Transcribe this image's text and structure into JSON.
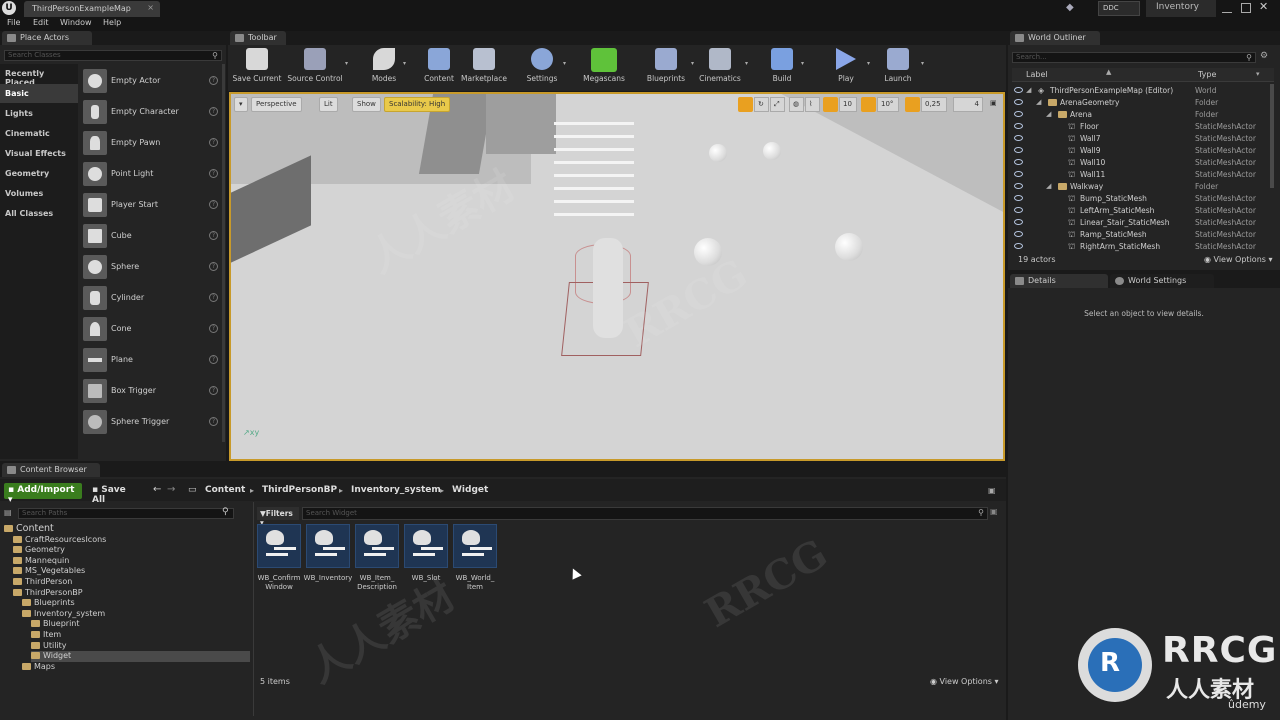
{
  "title_bar": {
    "map_tab": "ThirdPersonExampleMap",
    "ddc_label": "DDC",
    "project_label": "Inventory"
  },
  "menu": [
    "File",
    "Edit",
    "Window",
    "Help"
  ],
  "place_actors": {
    "tab_label": "Place Actors",
    "search_placeholder": "Search Classes",
    "categories": [
      "Recently Placed",
      "Basic",
      "Lights",
      "Cinematic",
      "Visual Effects",
      "Geometry",
      "Volumes",
      "All Classes"
    ],
    "selected_category": "Basic",
    "actors": [
      "Empty Actor",
      "Empty Character",
      "Empty Pawn",
      "Point Light",
      "Player Start",
      "Cube",
      "Sphere",
      "Cylinder",
      "Cone",
      "Plane",
      "Box Trigger",
      "Sphere Trigger"
    ]
  },
  "toolbar": {
    "tab_label": "Toolbar",
    "buttons": [
      {
        "label": "Save Current",
        "icon": "save-icon",
        "color": "#d8d8d8"
      },
      {
        "label": "Source Control",
        "icon": "source-control-icon",
        "color": "#9aa0b8"
      },
      {
        "label": "Modes",
        "icon": "modes-icon",
        "color": "#d8d8d8"
      },
      {
        "label": "Content",
        "icon": "content-icon",
        "color": "#8aa6d8"
      },
      {
        "label": "Marketplace",
        "icon": "marketplace-icon",
        "color": "#b8c0d0"
      },
      {
        "label": "Settings",
        "icon": "settings-icon",
        "color": "#8aa6d8"
      },
      {
        "label": "Megascans",
        "icon": "megascans-icon",
        "color": "#5fc23a"
      },
      {
        "label": "Blueprints",
        "icon": "blueprints-icon",
        "color": "#9aaad0"
      },
      {
        "label": "Cinematics",
        "icon": "cinematics-icon",
        "color": "#b0b8c8"
      },
      {
        "label": "Build",
        "icon": "build-icon",
        "color": "#7aa0e0"
      },
      {
        "label": "Play",
        "icon": "play-icon",
        "color": "#8aa6e8"
      },
      {
        "label": "Launch",
        "icon": "launch-icon",
        "color": "#9aaad0"
      }
    ]
  },
  "viewport": {
    "perspective": "Perspective",
    "lit": "Lit",
    "show": "Show",
    "scalability": "Scalability: High",
    "grid_snap": "10",
    "rot_snap": "10°",
    "scale_snap": "0,25",
    "cam_speed": "4"
  },
  "outliner": {
    "tab_label": "World Outliner",
    "search_placeholder": "Search...",
    "col_label": "Label",
    "col_type": "Type",
    "rows": [
      {
        "name": "ThirdPersonExampleMap (Editor)",
        "type": "World",
        "indent": 0,
        "kind": "world"
      },
      {
        "name": "ArenaGeometry",
        "type": "Folder",
        "indent": 1,
        "kind": "folder"
      },
      {
        "name": "Arena",
        "type": "Folder",
        "indent": 2,
        "kind": "folder"
      },
      {
        "name": "Floor",
        "type": "StaticMeshActor",
        "indent": 3,
        "kind": "mesh"
      },
      {
        "name": "Wall7",
        "type": "StaticMeshActor",
        "indent": 3,
        "kind": "mesh"
      },
      {
        "name": "Wall9",
        "type": "StaticMeshActor",
        "indent": 3,
        "kind": "mesh"
      },
      {
        "name": "Wall10",
        "type": "StaticMeshActor",
        "indent": 3,
        "kind": "mesh"
      },
      {
        "name": "Wall11",
        "type": "StaticMeshActor",
        "indent": 3,
        "kind": "mesh"
      },
      {
        "name": "Walkway",
        "type": "Folder",
        "indent": 2,
        "kind": "folder"
      },
      {
        "name": "Bump_StaticMesh",
        "type": "StaticMeshActor",
        "indent": 3,
        "kind": "mesh"
      },
      {
        "name": "LeftArm_StaticMesh",
        "type": "StaticMeshActor",
        "indent": 3,
        "kind": "mesh"
      },
      {
        "name": "Linear_Stair_StaticMesh",
        "type": "StaticMeshActor",
        "indent": 3,
        "kind": "mesh"
      },
      {
        "name": "Ramp_StaticMesh",
        "type": "StaticMeshActor",
        "indent": 3,
        "kind": "mesh"
      },
      {
        "name": "RightArm_StaticMesh",
        "type": "StaticMeshActor",
        "indent": 3,
        "kind": "mesh"
      }
    ],
    "actor_count": "19 actors",
    "view_options": "View Options"
  },
  "details": {
    "tab_label": "Details",
    "world_settings_tab": "World Settings",
    "empty_text": "Select an object to view details."
  },
  "content_browser": {
    "tab_label": "Content Browser",
    "add_import": "Add/Import",
    "save_all": "Save All",
    "breadcrumbs": [
      "Content",
      "ThirdPersonBP",
      "Inventory_system",
      "Widget"
    ],
    "paths_placeholder": "Search Paths",
    "filters": "Filters",
    "asset_search_placeholder": "Search Widget",
    "tree": [
      {
        "name": "Content",
        "depth": 0
      },
      {
        "name": "CraftResourcesIcons",
        "depth": 1
      },
      {
        "name": "Geometry",
        "depth": 1
      },
      {
        "name": "Mannequin",
        "depth": 1
      },
      {
        "name": "MS_Vegetables",
        "depth": 1
      },
      {
        "name": "ThirdPerson",
        "depth": 1
      },
      {
        "name": "ThirdPersonBP",
        "depth": 1
      },
      {
        "name": "Blueprints",
        "depth": 2
      },
      {
        "name": "Inventory_system",
        "depth": 2
      },
      {
        "name": "Blueprint",
        "depth": 3
      },
      {
        "name": "Item",
        "depth": 3
      },
      {
        "name": "Utility",
        "depth": 3
      },
      {
        "name": "Widget",
        "depth": 3
      },
      {
        "name": "Maps",
        "depth": 2
      }
    ],
    "assets": [
      "WB_Confirm Window",
      "WB_Inventory",
      "WB_Item_ Description",
      "WB_Slot",
      "WB_World_ Item"
    ],
    "items_count": "5 items",
    "view_options": "View Options"
  },
  "watermark": {
    "brand": "RRCG",
    "brand_cn": "人人素材",
    "udemy": "ûdemy"
  }
}
